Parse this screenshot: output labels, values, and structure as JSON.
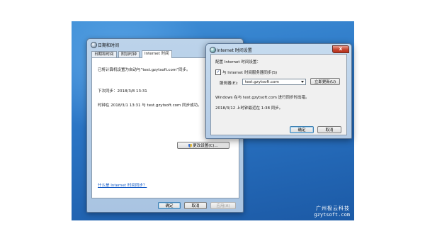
{
  "window_main": {
    "title": "日期和时间",
    "tabs": [
      {
        "label": "日期和时间"
      },
      {
        "label": "附加时钟"
      },
      {
        "label": "Internet 时间"
      }
    ],
    "texts": {
      "line1": "已将计算机设置为自动与“test.gzytsoft.com”同步。",
      "line2": "下次同步：2018/3/8 13:31",
      "line3": "时钟在 2018/3/1 13:31 与 test.gzytsoft.com 同步成功。"
    },
    "change_settings_label": "更改设置(C)...",
    "help_link": "什么是 Internet 时间同步？",
    "ok_label": "确定",
    "cancel_label": "取消",
    "apply_label": "应用(A)"
  },
  "dialog": {
    "title": "Internet 时间设置",
    "close_glyph": "X",
    "section_label": "配置 Internet 时间设置：",
    "sync_checkbox_label": "与 Internet 时间服务器同步(S)",
    "sync_checked": true,
    "server_label": "服务器(E):",
    "server_value": "test.gzytsoft.com",
    "update_now_label": "立即更新(U)",
    "status_line1": "Windows 在与 test.gzytsoft.com 进行同步时出错。",
    "status_line2": "2018/3/12 上时钟最近在 1:38 同步。",
    "ok_label": "确定",
    "cancel_label": "取消"
  },
  "watermark": {
    "line1": "广州极云科技",
    "line2": "gzytsoft.com"
  },
  "colors": {
    "desktop": "#2a74c4",
    "link": "#0b55c4",
    "close_button": "#c6452f"
  }
}
